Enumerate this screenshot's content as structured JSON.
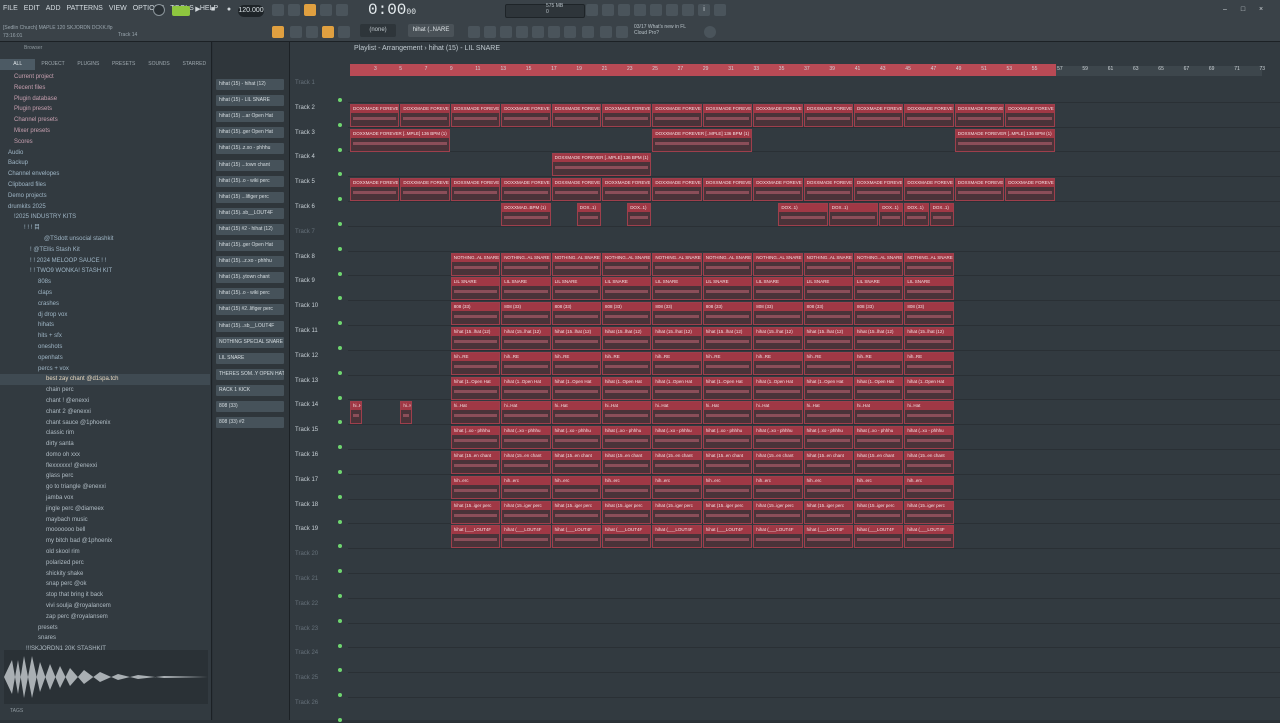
{
  "menu": [
    "FILE",
    "EDIT",
    "ADD",
    "PATTERNS",
    "VIEW",
    "OPTIONS",
    "TOOLS",
    "HELP"
  ],
  "song": {
    "name": "[Sedlin Church] MAPLE 120 SKJORDN DCKK.flp",
    "time": "73:16:01",
    "track_hint": "Track 14"
  },
  "transport": {
    "tempo": "120.000",
    "time": "0:00",
    "time_sub": "00",
    "cpu": "575 MB",
    "cpu2": "0"
  },
  "toolbar": {
    "none_label": "(none)",
    "pattern_label": "hihat (..NARE",
    "news_line1": "03/17 What's new in FL",
    "news_line2": "Cloud Pro?"
  },
  "browser": {
    "title": "Browser",
    "tabs": [
      "ALL",
      "PROJECT",
      "PLUGINS",
      "PRESETS",
      "SOUNDS",
      "STARRED"
    ],
    "items": [
      "Current project",
      "Recent files",
      "Plugin database",
      "Plugin presets",
      "Channel presets",
      "Mixer presets",
      "Scores",
      "Audio",
      "Backup",
      "Channel envelopes",
      "Clipboard files",
      "Demo projects",
      "drumkits 2025",
      "!2025 INDUSTRY KITS",
      "! ! ! 目",
      "@TSdott unsocial stashkit",
      "! @TEllis Stash Kit",
      "! ! 2024 MELOOP SAUCE ! !",
      "! ! TWO9 WONKA! STASH KIT",
      "808s",
      "claps",
      "crashes",
      "dj drop vox",
      "hihats",
      "hits + sfx",
      "oneshots",
      "openhats",
      "percs + vox",
      "best zay chant @d1spa.tch",
      "chain perc",
      "chant ! @enexxi",
      "chant 2 @enexxi",
      "chant sauce @1phoenix",
      "classic rim",
      "dirty santa",
      "domo oh xxx",
      "flexxxxxx! @enexxi",
      "glass perc",
      "go to triangle @enexxi",
      "jamba vox",
      "jingle perc @diameex",
      "maybach music",
      "mooooooo bell",
      "my bitch bad @1phoenix",
      "old skool rim",
      "polarized perc",
      "shickity shake",
      "snap perc @ok",
      "stop that bring it back",
      "vivi soulja @royalancem",
      "zap perc @royalansem",
      "presets",
      "snares",
      "!!!SKJORDN1 20K STASHKIT"
    ],
    "tags": "TAGS"
  },
  "channels": [
    "hihat (15) - hihat (12)",
    "hihat (15) - LIL SNARE",
    "hihat (15) ...ar Open Hat",
    "hihat (15)..ger Open Hat",
    "hihat (15)..z.xo - phhhu",
    "hihat (15) ...town chant",
    "hihat (15)..o - wiki perc",
    "hihat (15) ...lifiger perc",
    "hihat (15)..sb__LOUT4F",
    "hihat (15) #2 - hihat (12)",
    "hihat (15)..ger Open Hat",
    "hihat (15)...z.xo - phhhu",
    "hihat (15)..ytown chant",
    "hihat (15)..o - wiki perc",
    "hihat (15) #2..lifiger perc",
    "hihat (15)...sb__LOUT4F",
    "NOTHING SPECIAL SNARE",
    "LIL SNARE",
    "THERES SOM..Y OPEN HAT",
    "RACK 1 KICK",
    "808 (33)",
    "808 (33) #2"
  ],
  "playlist": {
    "title": "Playlist - Arrangement › hihat (15) - LIL SNARE",
    "ruler": [
      "3",
      "5",
      "7",
      "9",
      "11",
      "13",
      "15",
      "17",
      "19",
      "21",
      "23",
      "25",
      "27",
      "29",
      "31",
      "33",
      "35",
      "37",
      "39",
      "41",
      "43",
      "45",
      "47",
      "49",
      "51",
      "53",
      "55",
      "57",
      "59",
      "61",
      "63",
      "65",
      "67",
      "69",
      "71",
      "73"
    ],
    "tracks": [
      "Track 1",
      "Track 2",
      "Track 3",
      "Track 4",
      "Track 5",
      "Track 6",
      "Track 7",
      "Track 8",
      "Track 9",
      "Track 10",
      "Track 11",
      "Track 12",
      "Track 13",
      "Track 14",
      "Track 15",
      "Track 16",
      "Track 17",
      "Track 18",
      "Track 19",
      "Track 20",
      "Track 21",
      "Track 22",
      "Track 23",
      "Track 24",
      "Track 25",
      "Track 26"
    ],
    "clip_labels": {
      "t2": "DOXXMADE FOREVER [..MPLE] 136 BPM (1)",
      "t6": "DOXXMAD..BPM (1)",
      "t6b": "DOX..1)",
      "t8": "NOTHING..AL SNARE",
      "t9": "LIL SNARE",
      "t10": "808 (33)",
      "t10b": "808 (33) #2",
      "t11": "hihat (15..lhat (12)",
      "t12": "hih..RE",
      "t13": "hihat (1..Open Hat",
      "t14": "hi..Hat",
      "t15": "hihat (..xo - phhhu",
      "t16": "hihat (15..en chant",
      "t17": "hih..erc",
      "t18": "hihat (15..iger perc",
      "t19": "hihat (___LOUT4F"
    }
  }
}
